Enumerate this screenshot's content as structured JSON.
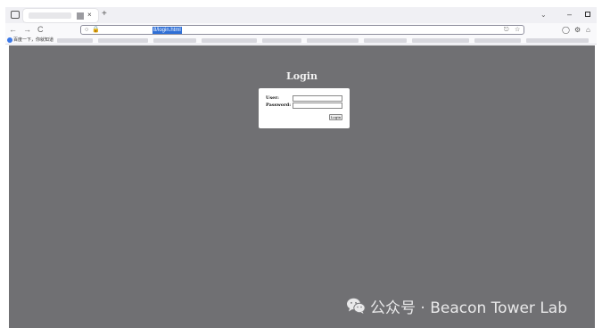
{
  "browser": {
    "tab": {
      "close_glyph": "×"
    },
    "new_tab_glyph": "+",
    "nav": {
      "back_glyph": "←",
      "forward_glyph": "→",
      "reload_glyph": "C"
    },
    "address_bar": {
      "url": "8/login.html"
    },
    "bookmarks": [
      {
        "label": "百度一下，你就知道",
        "icon": "baidu-icon"
      }
    ],
    "icons": [
      "window-icon",
      "tabs-chevron-icon",
      "minimize-icon",
      "maximize-icon",
      "page-icon",
      "lock-icon",
      "translate-icon",
      "star-icon",
      "shield-icon",
      "extension-icon",
      "menu-icon"
    ]
  },
  "page": {
    "title": "Login",
    "form": {
      "user_label": "User:",
      "password_label": "Password:",
      "user_value": "",
      "password_value": "",
      "submit_label": "Login"
    },
    "background_color": "#707073"
  },
  "watermark": {
    "text": "公众号 · Beacon Tower Lab",
    "icon": "wechat-icon"
  }
}
